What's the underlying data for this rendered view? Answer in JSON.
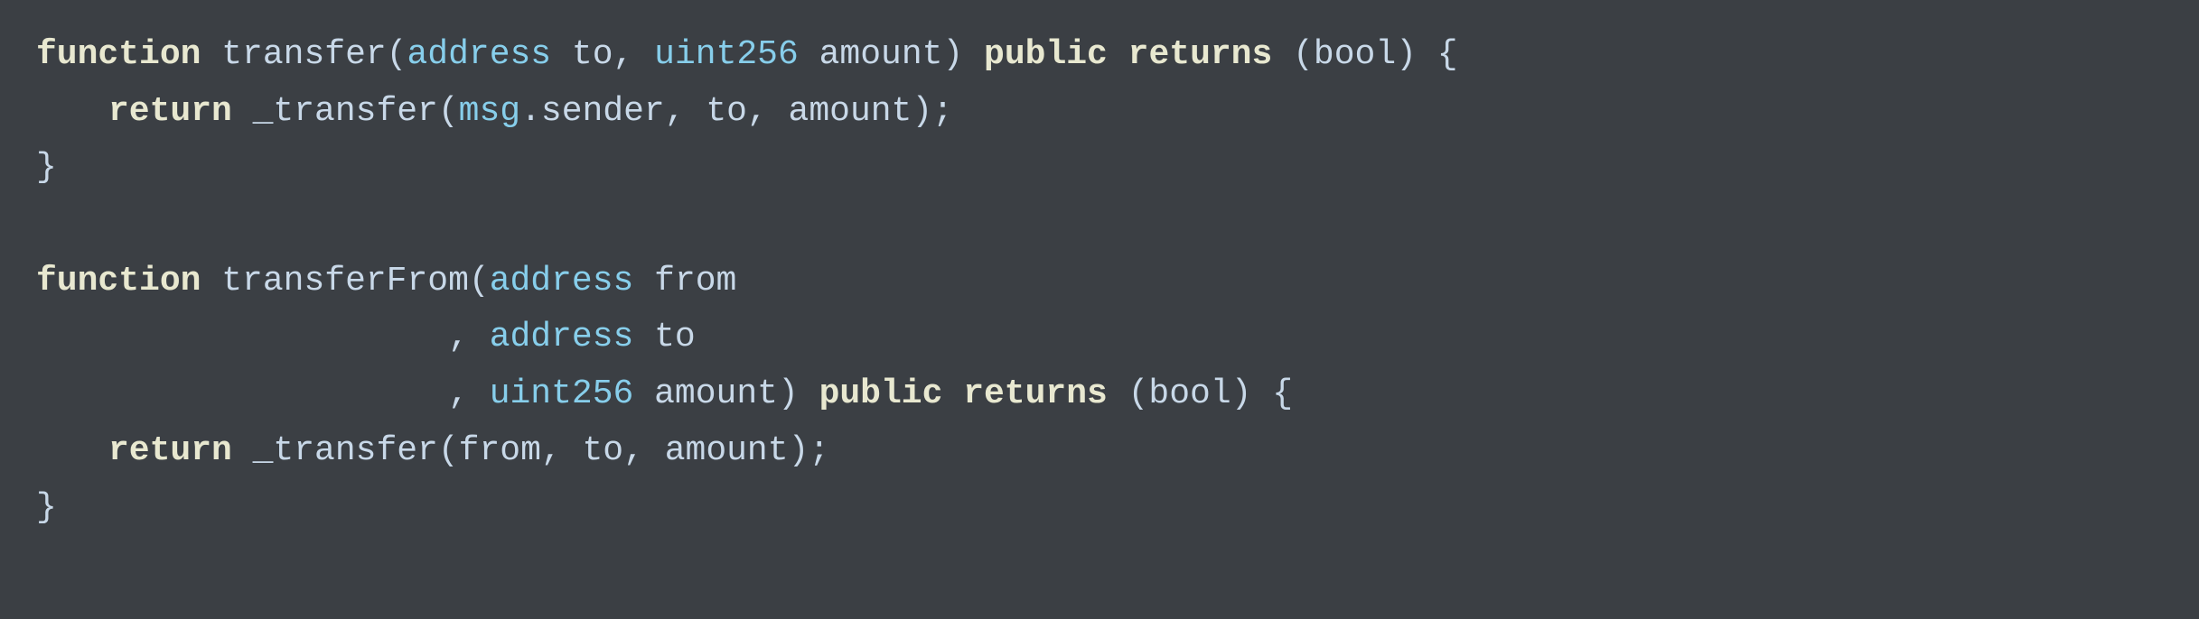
{
  "code": {
    "lines": [
      {
        "id": "line1",
        "parts": [
          {
            "text": "function",
            "style": "kw"
          },
          {
            "text": " transfer(",
            "style": "plain"
          },
          {
            "text": "address",
            "style": "type"
          },
          {
            "text": " to, ",
            "style": "plain"
          },
          {
            "text": "uint256",
            "style": "type"
          },
          {
            "text": " amount) ",
            "style": "plain"
          },
          {
            "text": "public returns",
            "style": "kw"
          },
          {
            "text": " (",
            "style": "plain"
          },
          {
            "text": "bool",
            "style": "plain"
          },
          {
            "text": ") {",
            "style": "plain"
          }
        ]
      },
      {
        "id": "line2",
        "indent": "indent1",
        "parts": [
          {
            "text": "return",
            "style": "kw"
          },
          {
            "text": " _transfer(",
            "style": "plain"
          },
          {
            "text": "msg",
            "style": "fn-name"
          },
          {
            "text": ".sender, to, amount);",
            "style": "plain"
          }
        ]
      },
      {
        "id": "line3",
        "parts": [
          {
            "text": "}",
            "style": "plain"
          }
        ]
      },
      {
        "id": "line4",
        "empty": true
      },
      {
        "id": "line5",
        "parts": [
          {
            "text": "function",
            "style": "kw"
          },
          {
            "text": " transferFrom(",
            "style": "plain"
          },
          {
            "text": "address",
            "style": "type"
          },
          {
            "text": " from",
            "style": "plain"
          }
        ]
      },
      {
        "id": "line6",
        "indent": "indent2",
        "parts": [
          {
            "text": ", ",
            "style": "plain"
          },
          {
            "text": "address",
            "style": "type"
          },
          {
            "text": " to",
            "style": "plain"
          }
        ]
      },
      {
        "id": "line7",
        "indent": "indent2",
        "parts": [
          {
            "text": ", ",
            "style": "plain"
          },
          {
            "text": "uint256",
            "style": "type"
          },
          {
            "text": " amount) ",
            "style": "plain"
          },
          {
            "text": "public returns",
            "style": "kw"
          },
          {
            "text": " (",
            "style": "plain"
          },
          {
            "text": "bool",
            "style": "plain"
          },
          {
            "text": ") {",
            "style": "plain"
          }
        ]
      },
      {
        "id": "line8",
        "indent": "indent1",
        "parts": [
          {
            "text": "return",
            "style": "kw"
          },
          {
            "text": " _transfer(from, to, amount);",
            "style": "plain"
          }
        ]
      },
      {
        "id": "line9",
        "parts": [
          {
            "text": "}",
            "style": "plain"
          }
        ]
      }
    ]
  }
}
